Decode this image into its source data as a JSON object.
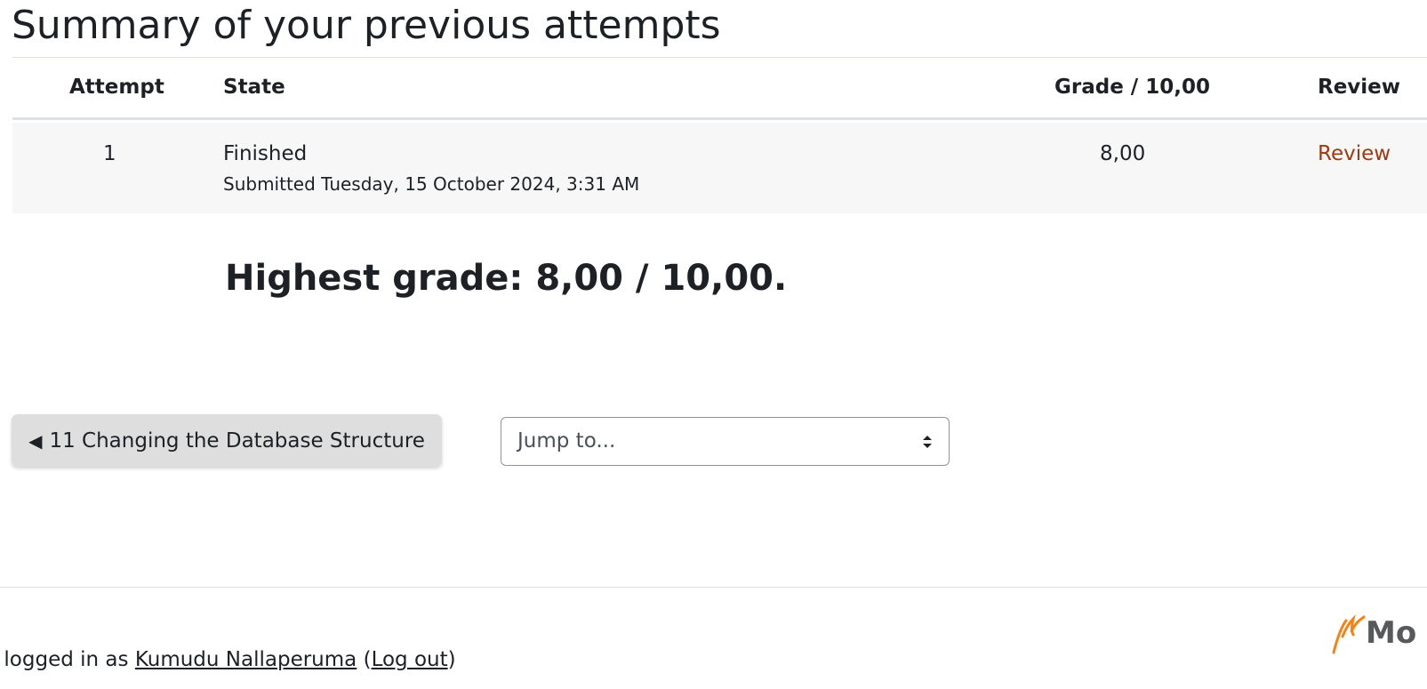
{
  "summary": {
    "heading": "Summary of your previous attempts"
  },
  "table": {
    "headers": {
      "attempt": "Attempt",
      "state": "State",
      "grade": "Grade / 10,00",
      "review": "Review"
    },
    "rows": [
      {
        "attempt": "1",
        "state": "Finished",
        "submitted": "Submitted Tuesday, 15 October 2024, 3:31 AM",
        "grade": "8,00",
        "review": "Review"
      }
    ]
  },
  "highest_grade": "Highest grade: 8,00 / 10,00.",
  "navigation": {
    "prev_arrow": "◀",
    "prev_label": "11 Changing the Database Structure",
    "jump_placeholder": "Jump to..."
  },
  "footer": {
    "login_prefix": "re logged in as ",
    "user_name": "Kumudu Nallaperuma",
    "open_paren": " (",
    "logout": "Log out",
    "close_paren": ")",
    "logo_text": "Mo"
  },
  "colors": {
    "link": "#a03a10",
    "row_bg": "#f7f7f7",
    "button_bg": "#dedede",
    "logo_orange": "#f98012"
  },
  "icons": {
    "select": "sort-arrows-icon",
    "logo": "moodle-logo-icon"
  }
}
